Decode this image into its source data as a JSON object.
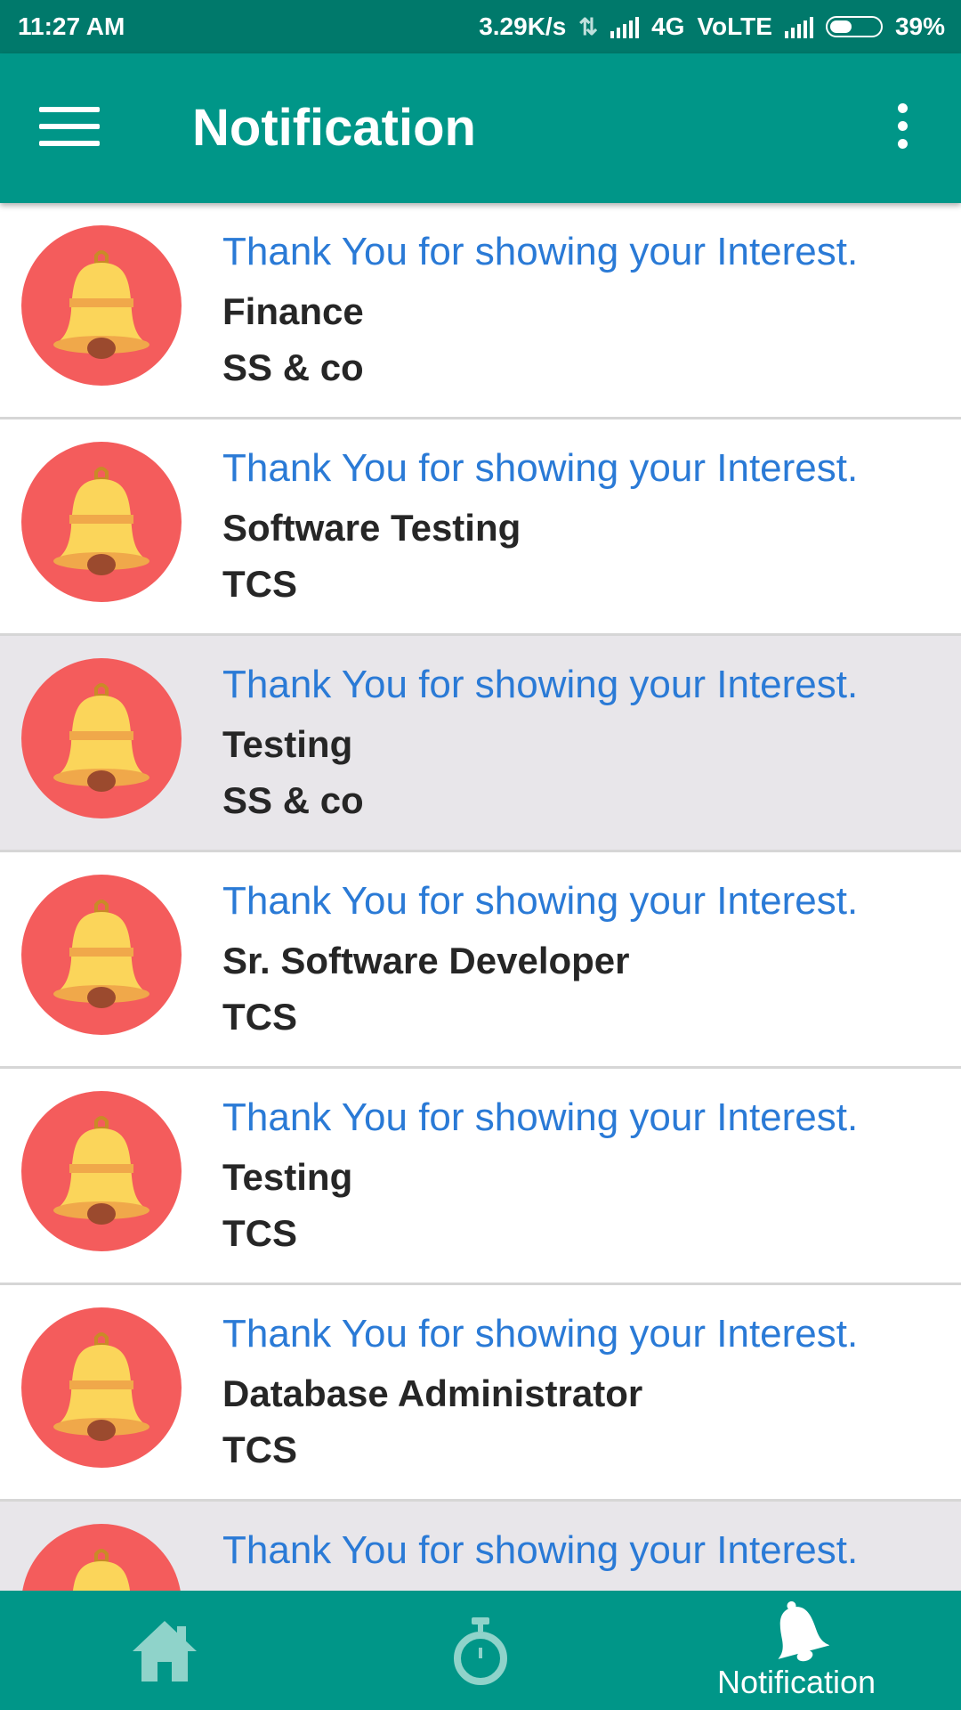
{
  "status_bar": {
    "time": "11:27 AM",
    "speed": "3.29K/s",
    "network": "4G",
    "volte": "VoLTE",
    "battery": "39%"
  },
  "app_bar": {
    "title": "Notification",
    "menu_icon": "hamburger-menu-icon",
    "more_icon": "more-vertical-icon"
  },
  "notifications": [
    {
      "message": "Thank You for showing your Interest.",
      "job": "Finance",
      "company": "SS & co"
    },
    {
      "message": "Thank You for showing your Interest.",
      "job": "Software Testing",
      "company": "TCS"
    },
    {
      "message": "Thank You for showing your Interest.",
      "job": "Testing",
      "company": "SS & co"
    },
    {
      "message": "Thank You for showing your Interest.",
      "job": "Sr. Software Developer",
      "company": "TCS"
    },
    {
      "message": "Thank You for showing your Interest.",
      "job": "Testing",
      "company": "TCS"
    },
    {
      "message": "Thank You for showing your Interest.",
      "job": "Database Administrator",
      "company": "TCS"
    },
    {
      "message": "Thank You for showing your Interest."
    }
  ],
  "bottom_nav": {
    "items": [
      {
        "icon": "home-icon"
      },
      {
        "icon": "stopwatch-icon"
      },
      {
        "icon": "bell-icon",
        "label": "Notification",
        "active": true
      }
    ]
  },
  "colors": {
    "status_bar": "#00796b",
    "app_bar": "#009688",
    "avatar": "#f45c5c",
    "bell": "#fbd55a",
    "message_text": "#2a7ad6",
    "highlight_row": "#e8e6ea"
  }
}
